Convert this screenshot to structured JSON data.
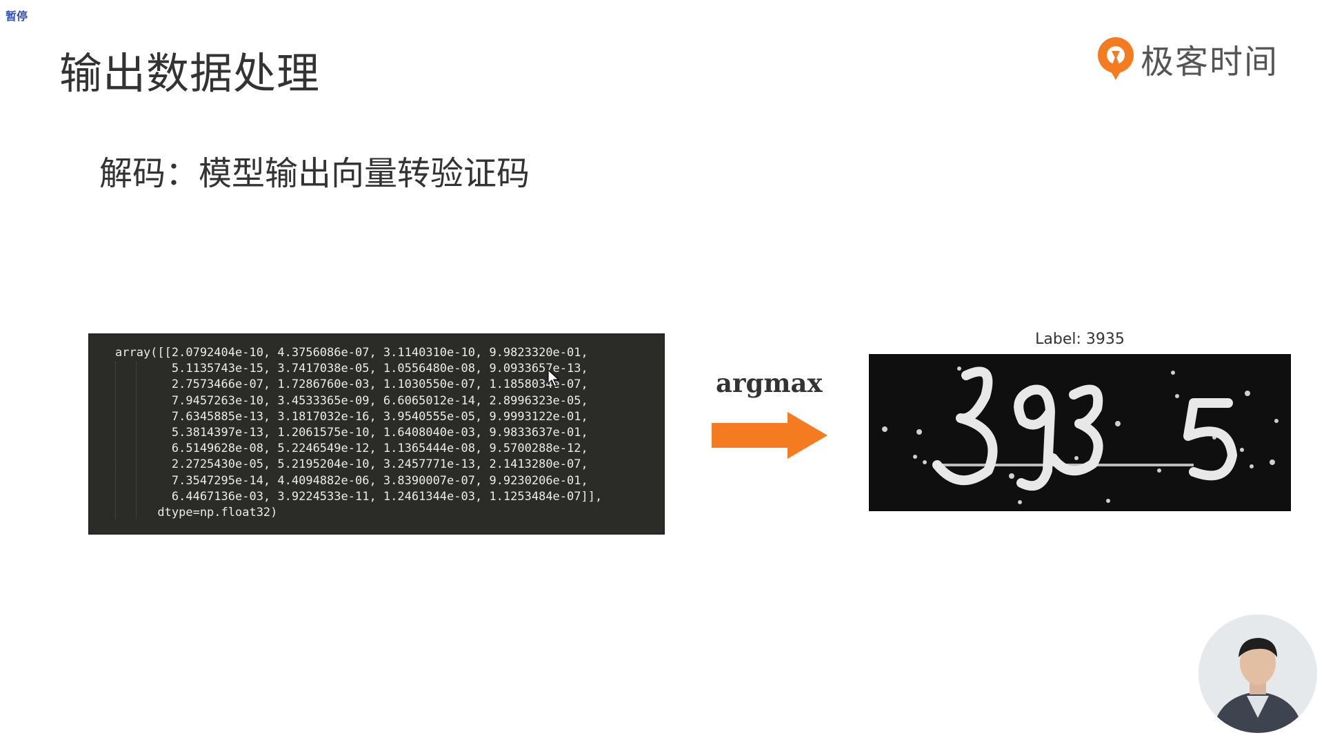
{
  "overlay": {
    "pause_text": "暂停"
  },
  "slide": {
    "title": "输出数据处理",
    "subtitle": "解码：模型输出向量转验证码"
  },
  "logo": {
    "text": "极客时间",
    "icon": "geektime-logo-icon",
    "accent": "#f47b20"
  },
  "code": {
    "lines": [
      "array([[2.0792404e-10, 4.3756086e-07, 3.1140310e-10, 9.9823320e-01,",
      "        5.1135743e-15, 3.7417038e-05, 1.0556480e-08, 9.0933657e-13,",
      "        2.7573466e-07, 1.7286760e-03, 1.1030550e-07, 1.1858034e-07,",
      "        7.9457263e-10, 3.4533365e-09, 6.6065012e-14, 2.8996323e-05,",
      "        7.6345885e-13, 3.1817032e-16, 3.9540555e-05, 9.9993122e-01,",
      "        5.3814397e-13, 1.2061575e-10, 1.6408040e-03, 9.9833637e-01,",
      "        6.5149628e-08, 5.2246549e-12, 1.1365444e-08, 9.5700288e-12,",
      "        2.2725430e-05, 5.2195204e-10, 3.2457771e-13, 2.1413280e-07,",
      "        7.3547295e-14, 4.4094882e-06, 3.8390007e-07, 9.9230206e-01,",
      "        6.4467136e-03, 3.9224533e-11, 1.2461344e-03, 1.1253484e-07]],",
      "      dtype=np.float32)"
    ],
    "background": "#2b2b28"
  },
  "arrow": {
    "label": "argmax",
    "color": "#f47b20"
  },
  "captcha": {
    "label": "Label: 3935",
    "glyphs": "3935"
  },
  "webcam": {
    "icon": "presenter-webcam"
  }
}
